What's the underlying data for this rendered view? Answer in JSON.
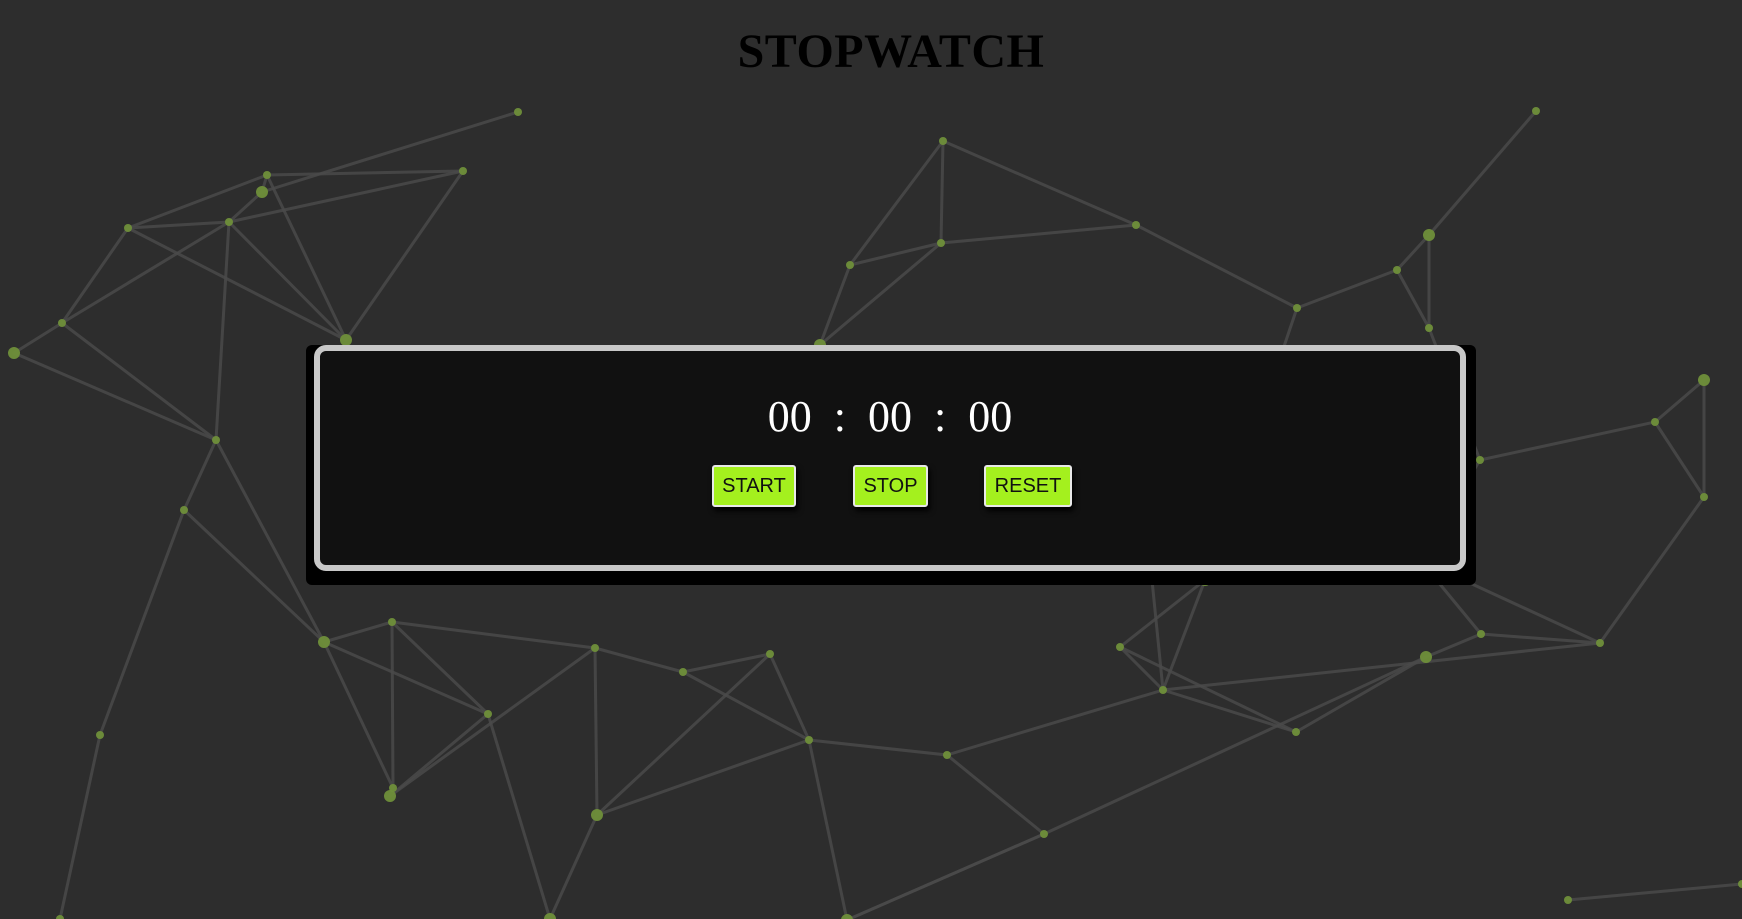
{
  "page": {
    "title": "STOPWATCH"
  },
  "stopwatch": {
    "hours": "00",
    "minutes": "00",
    "seconds": "00",
    "separator": ":"
  },
  "controls": {
    "start_label": "START",
    "stop_label": "STOP",
    "reset_label": "RESET"
  },
  "colors": {
    "background": "#2d2d2d",
    "panel": "#111111",
    "panel_border": "#c8c8c8",
    "button": "#a4f01e",
    "network_node": "#6f8f3a",
    "network_line": "#4a4a4a"
  }
}
